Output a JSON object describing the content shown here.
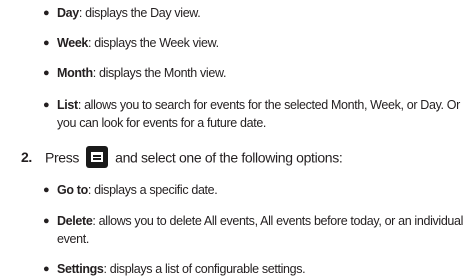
{
  "list_top": {
    "items": [
      {
        "term": "Day",
        "desc": ": displays the Day view."
      },
      {
        "term": "Week",
        "desc": ": displays the Week view."
      },
      {
        "term": "Month",
        "desc": ": displays the Month view."
      },
      {
        "term": "List",
        "desc": ": allows you to search for events for the selected Month, Week, or Day. Or you can look for events for a future date."
      }
    ]
  },
  "step2": {
    "number": "2.",
    "before_icon": "Press",
    "icon": "menu-key-icon",
    "after_icon": "and select one of the following options:"
  },
  "list_bottom": {
    "items": [
      {
        "term": "Go to",
        "desc": ": displays a specific date."
      },
      {
        "term": "Delete",
        "desc": ": allows you to delete All events, All events before today, or an individual event."
      },
      {
        "term": "Settings",
        "desc": ": displays a list of configurable settings."
      }
    ]
  }
}
